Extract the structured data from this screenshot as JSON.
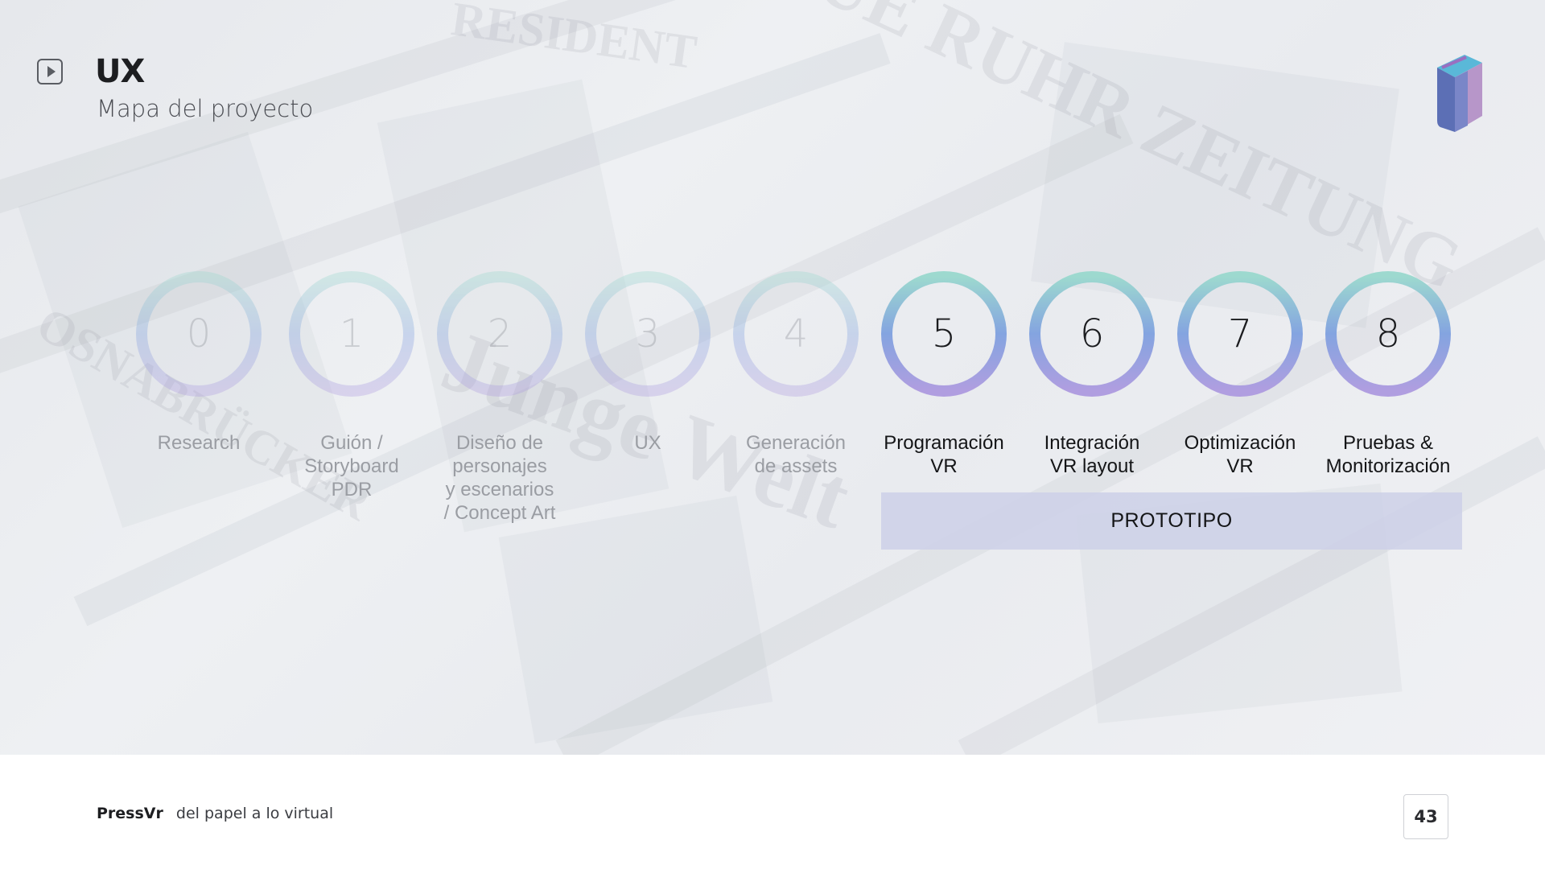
{
  "header": {
    "title": "UX",
    "subtitle": "Mapa del proyecto"
  },
  "steps": [
    {
      "number": "0",
      "label": "Research",
      "state": "faded"
    },
    {
      "number": "1",
      "label": "Guión /\nStoryboard\nPDR",
      "state": "faded"
    },
    {
      "number": "2",
      "label": "Diseño de\npersonajes\ny escenarios\n/ Concept Art",
      "state": "faded"
    },
    {
      "number": "3",
      "label": "UX",
      "state": "faded"
    },
    {
      "number": "4",
      "label": "Generación\nde assets",
      "state": "faded"
    },
    {
      "number": "5",
      "label": "Programación\nVR",
      "state": "active"
    },
    {
      "number": "6",
      "label": "Integración\nVR layout",
      "state": "active"
    },
    {
      "number": "7",
      "label": "Optimización\nVR",
      "state": "active"
    },
    {
      "number": "8",
      "label": "Pruebas &\nMonitorización",
      "state": "active"
    }
  ],
  "phase_bar": {
    "label": "PROTOTIPO"
  },
  "footer": {
    "brand": "PressVr",
    "tagline": "del papel a lo virtual",
    "page_number": "43"
  },
  "colors": {
    "ring_gradient_top": "#9dd9cf",
    "ring_gradient_mid": "#84a4e0",
    "ring_gradient_bottom": "#b09ee0",
    "phase_bar": "#cdd0e8",
    "logo_primary": "#5c6fb5",
    "logo_accent": "#5ab8d8",
    "logo_secondary": "#b796c9"
  },
  "icons": {
    "play": "play-icon",
    "logo": "book-logo-icon"
  }
}
